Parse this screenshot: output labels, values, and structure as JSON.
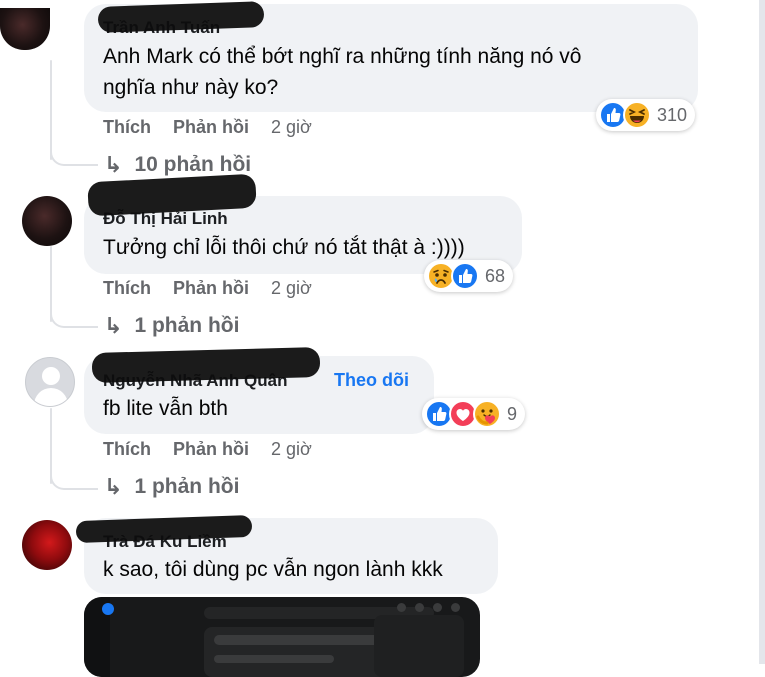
{
  "comments": [
    {
      "author": "Trần Anh Tuấn",
      "text_lines": [
        "Anh Mark có thể bớt nghĩ ra những tính năng nó vô",
        "nghĩa như này ko?"
      ],
      "like_label": "Thích",
      "reply_label": "Phản hồi",
      "time": "2 giờ",
      "reactions": [
        "like",
        "haha"
      ],
      "reaction_count": "310",
      "replies_label": "10 phản hồi",
      "avatar_style": "dark"
    },
    {
      "author": "Đỗ Thị Hải Linh",
      "text_lines": [
        "Tưởng chỉ lỗi thôi chứ nó tắt thật à :))))"
      ],
      "like_label": "Thích",
      "reply_label": "Phản hồi",
      "time": "2 giờ",
      "reactions": [
        "sad",
        "like"
      ],
      "reaction_count": "68",
      "replies_label": "1 phản hồi",
      "avatar_style": "dark"
    },
    {
      "author": "Nguyễn Nhã Anh Quân",
      "follow_label": "Theo dõi",
      "text_lines": [
        "fb lite vẫn bth"
      ],
      "like_label": "Thích",
      "reply_label": "Phản hồi",
      "time": "2 giờ",
      "reactions": [
        "like",
        "love",
        "care"
      ],
      "reaction_count": "9",
      "replies_label": "1 phản hồi",
      "avatar_style": "default"
    },
    {
      "author": "Trà Đá Ku Liềm",
      "text_lines": [
        "k sao, tôi dùng pc vẫn ngon lành kkk"
      ],
      "avatar_style": "red",
      "has_photo": true
    }
  ],
  "icons": {
    "reply_arrow": "↳",
    "like": "like-icon",
    "haha": "haha-icon",
    "sad": "sad-icon",
    "love": "love-icon",
    "care": "care-icon"
  },
  "colors": {
    "bubble": "#f0f2f5",
    "meta_text": "#65676b",
    "link_blue": "#1877f2",
    "like_blue": "#1877f2",
    "love_red": "#f33e58",
    "emoji_yellow": "#f7b125"
  }
}
